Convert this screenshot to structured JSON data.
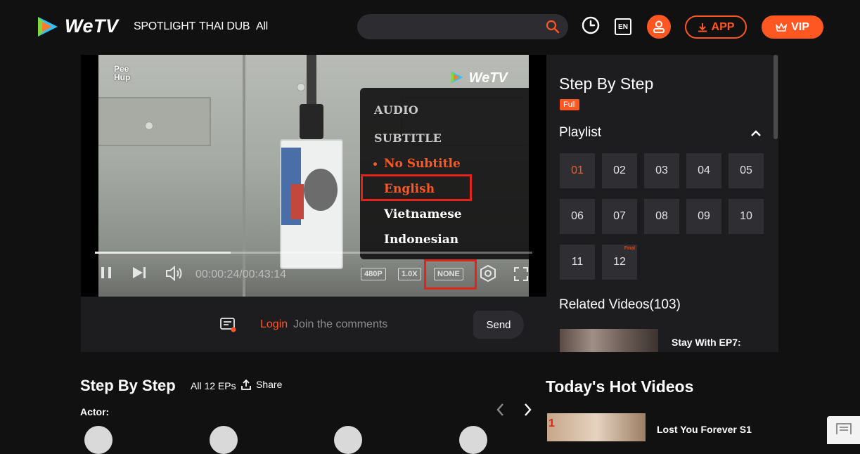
{
  "header": {
    "brand": "WeTV",
    "nav": [
      "SPOTLIGHT",
      "THAI DUB",
      "All"
    ],
    "search_placeholder": "",
    "language": "EN",
    "app_label": "APP",
    "vip_label": "VIP"
  },
  "player": {
    "watermark_left": "Pee Hup",
    "watermark_right": "WeTV",
    "menu": {
      "audio_label": "AUDIO",
      "subtitle_label": "SUBTITLE",
      "options": [
        "No Subtitle",
        "English",
        "Vietnamese",
        "Indonesian"
      ],
      "selected": "No Subtitle"
    },
    "progress_fraction": 0.31,
    "time": "00:00:24/00:43:14",
    "quality": "480P",
    "speed": "1.0X",
    "subtitle_state": "NONE"
  },
  "comments": {
    "login_label": "Login",
    "prompt": "Join the comments",
    "send_label": "Send"
  },
  "sidebar": {
    "title": "Step By Step",
    "badge": "Full",
    "playlist_label": "Playlist",
    "episodes": [
      "01",
      "02",
      "03",
      "04",
      "05",
      "06",
      "07",
      "08",
      "09",
      "10",
      "11",
      "12"
    ],
    "active_episode": "01",
    "final_tag": "Final",
    "related_label": "Related Videos(103)",
    "related_first": "Stay With EP7:"
  },
  "below": {
    "title": "Step By Step",
    "episodes_count": "All 12 EPs",
    "share_label": "Share",
    "actor_label": "Actor:",
    "hot_title": "Today's Hot Videos",
    "hot_rank": "1",
    "hot_first": "Lost You Forever S1"
  },
  "colors": {
    "accent": "#ff5722",
    "highlight_box": "#e1251b",
    "panel": "#1d1d20",
    "background": "#111112"
  }
}
